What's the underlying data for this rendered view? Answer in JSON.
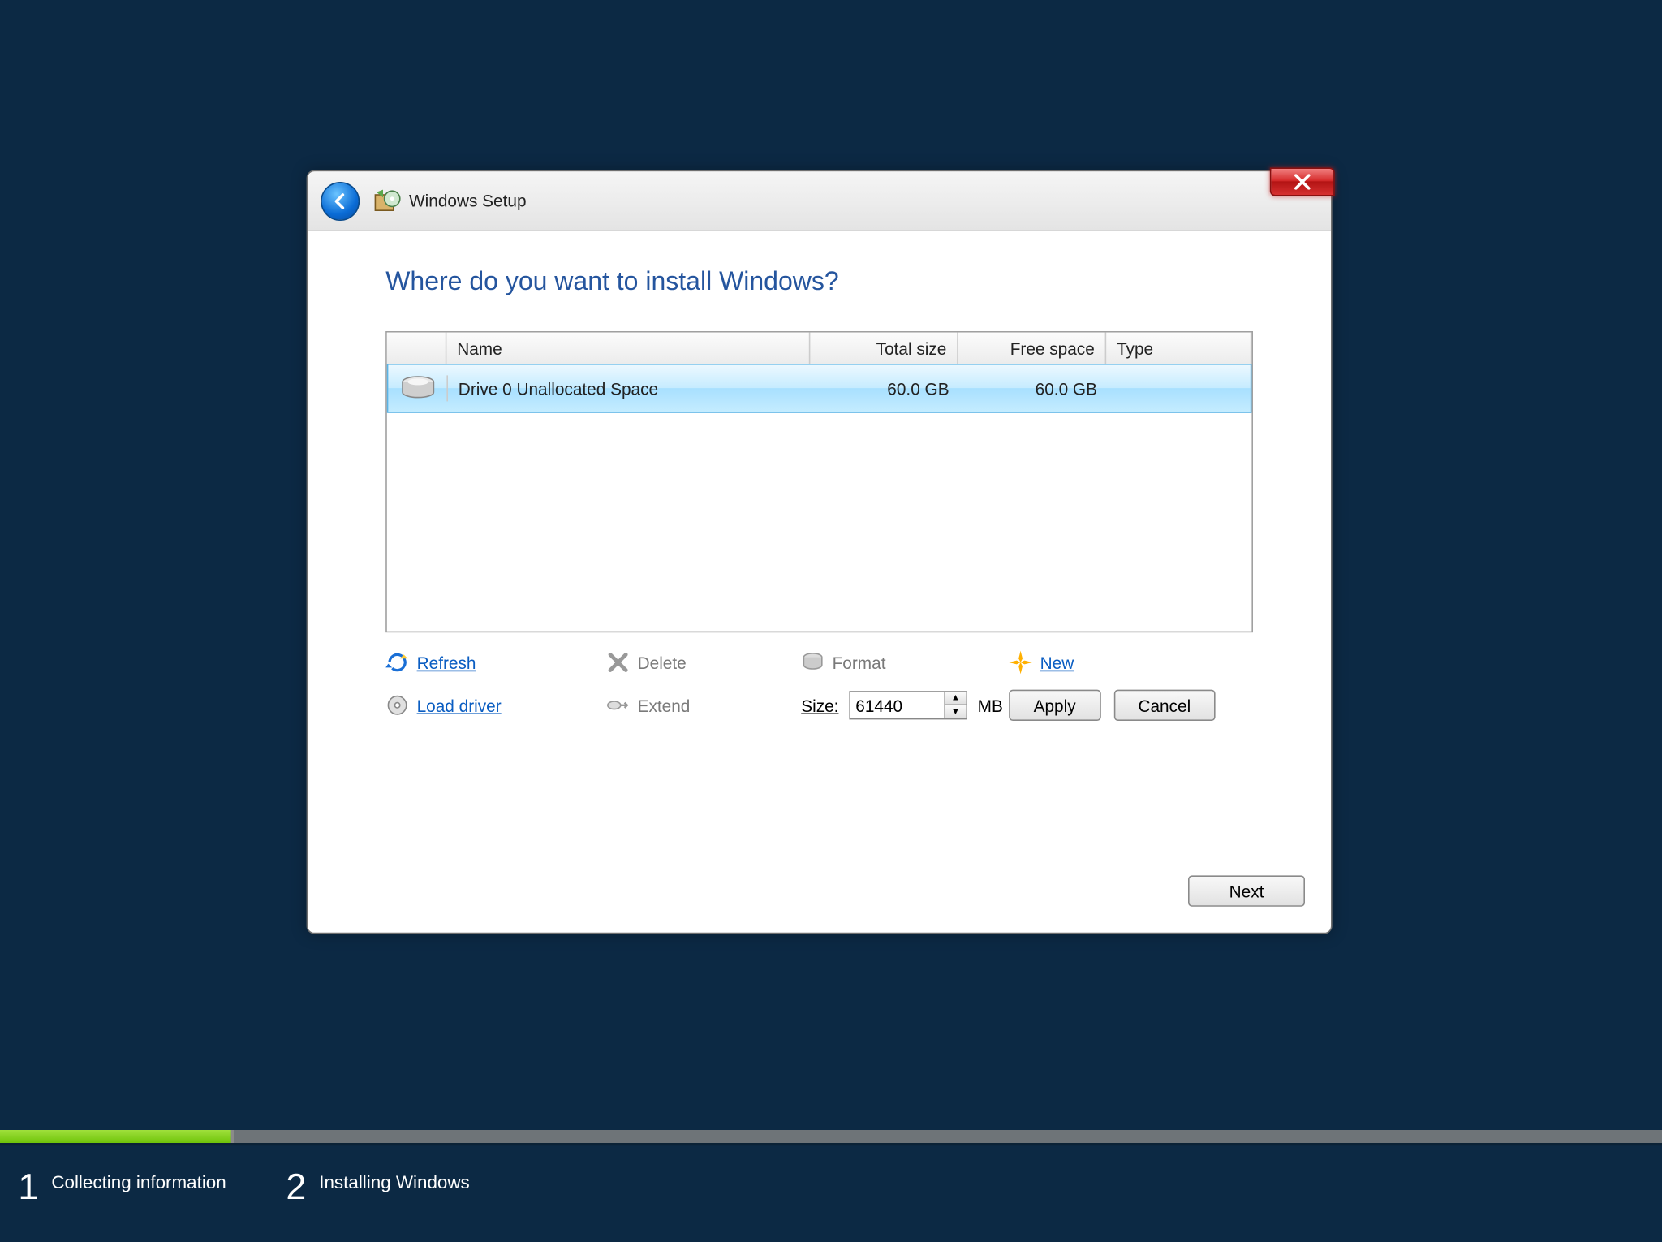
{
  "titlebar": {
    "app_title": "Windows Setup"
  },
  "heading": "Where do you want to install Windows?",
  "columns": {
    "name": "Name",
    "total": "Total size",
    "free": "Free space",
    "type": "Type"
  },
  "drives": [
    {
      "name": "Drive 0 Unallocated Space",
      "total": "60.0 GB",
      "free": "60.0 GB",
      "type": ""
    }
  ],
  "actions": {
    "refresh": "Refresh",
    "delete": "Delete",
    "format": "Format",
    "new": "New",
    "load_driver": "Load driver",
    "extend": "Extend"
  },
  "size": {
    "label": "Size:",
    "value": "61440",
    "unit": "MB"
  },
  "buttons": {
    "apply": "Apply",
    "cancel": "Cancel",
    "next": "Next"
  },
  "footer_steps": [
    {
      "num": "1",
      "label": "Collecting information"
    },
    {
      "num": "2",
      "label": "Installing Windows"
    }
  ]
}
